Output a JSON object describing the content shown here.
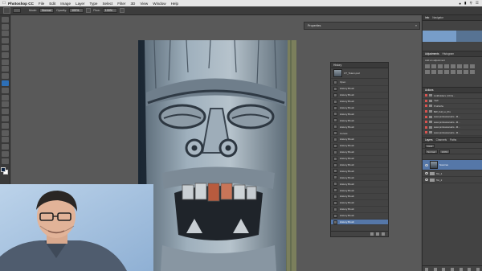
{
  "menubar": {
    "app_name": "Photoshop CC",
    "items": [
      "File",
      "Edit",
      "Image",
      "Layer",
      "Type",
      "Select",
      "Filter",
      "3D",
      "View",
      "Window",
      "Help"
    ]
  },
  "options_bar": {
    "mode_label": "Mode:",
    "mode_value": "Normal",
    "opacity_label": "Opacity:",
    "opacity_value": "100%",
    "flow_label": "Flow:",
    "flow_value": "100%"
  },
  "properties_panel": {
    "title": "Properties"
  },
  "history_panel": {
    "tab": "History",
    "snapshot_label": "CT_Totem.psd",
    "rows": [
      "Open",
      "History Brush",
      "History Brush",
      "History Brush",
      "History Brush",
      "History Brush",
      "History Brush",
      "History Brush",
      "Curves",
      "History Brush",
      "History Brush",
      "History Brush",
      "History Brush",
      "History Brush",
      "History Brush",
      "History Brush",
      "History Brush",
      "History Brush",
      "History Brush",
      "History Brush",
      "History Brush",
      "History Brush",
      "History Brush",
      "History Brush",
      "History Brush",
      "History Brush",
      "History Brush"
    ],
    "selected_index": 26
  },
  "right_dock": {
    "info_tabs": [
      "Info",
      "Navigator"
    ],
    "adjustments_tabs": [
      "Adjustments",
      "Histogram"
    ],
    "adjustments_subtitle": "Add an adjustment",
    "actions_tab": "Actions",
    "actions_rows": [
      "LinkFolders | Chris...",
      "Yadi",
      "ProPaths",
      "BW_Full_to_Pro",
      "www.professionalcs...M...",
      "www.professionalcs...M...",
      "www.professionalcs...M...",
      "www.professionalcs...M..."
    ],
    "layers_tabs": [
      "Layers",
      "Channels",
      "Paths"
    ],
    "layers_kind": "Kind",
    "layers_blend": "Normal",
    "layers_opacity": "100%",
    "layers": [
      {
        "name": "Sources",
        "selected": true
      },
      {
        "name": "Tot_1",
        "selected": false
      },
      {
        "name": "Tot_2",
        "selected": false
      }
    ]
  },
  "colors": {
    "selection": "#5577a8",
    "panel_bg": "#434343",
    "canvas_bg": "#595959",
    "foreground_swatch": "#0e2442"
  }
}
